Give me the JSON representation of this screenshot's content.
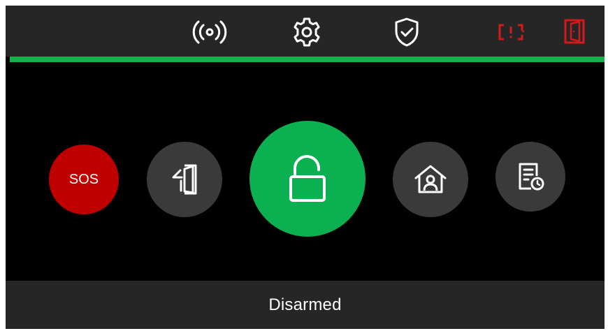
{
  "colors": {
    "background": "#000000",
    "bar": "#262626",
    "accent_green": "#15b14b",
    "arm_button_green": "#0bb050",
    "sos_red": "#c00000",
    "alert_red": "#d11a1a",
    "button_grey": "#3a3a3a",
    "icon_white": "#ffffff"
  },
  "topbar": {
    "icons": [
      "wireless-signal-icon",
      "gear-icon",
      "shield-check-icon",
      "tamper-alert-icon",
      "door-open-icon"
    ]
  },
  "main": {
    "sos_label": "SOS",
    "buttons": [
      "sos-button",
      "exit-door-button",
      "unlock-button",
      "home-user-button",
      "event-log-button"
    ]
  },
  "footer": {
    "status": "Disarmed"
  }
}
